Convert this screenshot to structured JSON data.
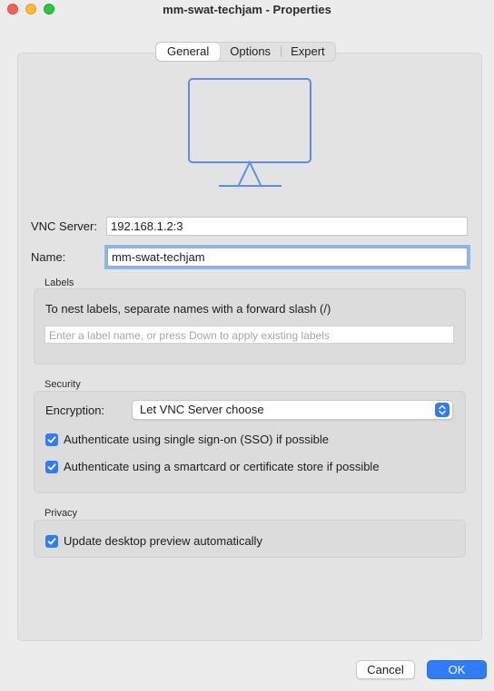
{
  "window": {
    "title": "mm-swat-techjam - Properties"
  },
  "tabs": [
    {
      "label": "General",
      "active": true
    },
    {
      "label": "Options",
      "active": false
    },
    {
      "label": "Expert",
      "active": false
    }
  ],
  "general": {
    "vnc_server_label": "VNC Server:",
    "vnc_server_value": "192.168.1.2:3",
    "name_label": "Name:",
    "name_value": "mm-swat-techjam"
  },
  "labels": {
    "section_title": "Labels",
    "instruction": "To nest labels, separate names with a forward slash (/)",
    "input_placeholder": "Enter a label name, or press Down to apply existing labels"
  },
  "security": {
    "section_title": "Security",
    "encryption_label": "Encryption:",
    "encryption_value": "Let VNC Server choose",
    "sso_label": "Authenticate using single sign-on (SSO) if possible",
    "sso_checked": true,
    "smartcard_label": "Authenticate using a smartcard or certificate store if possible",
    "smartcard_checked": true
  },
  "privacy": {
    "section_title": "Privacy",
    "preview_label": "Update desktop preview automatically",
    "preview_checked": true
  },
  "buttons": {
    "cancel": "Cancel",
    "ok": "OK"
  },
  "colors": {
    "accent": "#2f7cf6",
    "monitor_stroke": "#5b8ee6"
  },
  "icons": {
    "monitor": "desktop-monitor-icon",
    "checkbox": "checkmark-icon",
    "select_arrows": "up-down-chevron-icon"
  }
}
